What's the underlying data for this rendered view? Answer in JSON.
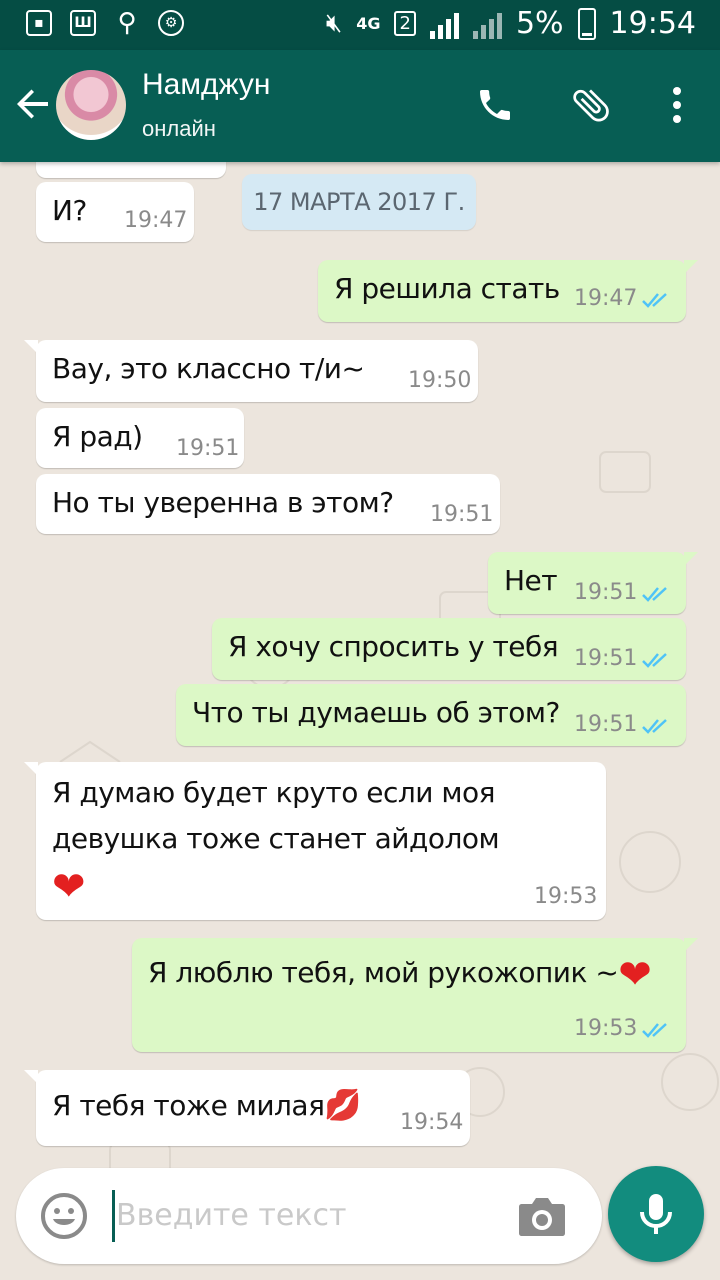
{
  "status_bar": {
    "time": "19:54",
    "battery": "5%",
    "network": "4G",
    "sim": "2"
  },
  "header": {
    "contact_name": "Намджун",
    "status": "онлайн"
  },
  "date_chip": "17 МАРТА 2017 Г.",
  "messages": [
    {
      "text": "И?",
      "time": "19:47",
      "direction": "in"
    },
    {
      "text": "Я решила стать",
      "time": "19:47",
      "direction": "out"
    },
    {
      "text": "Вау, это классно т/и~",
      "time": "19:50",
      "direction": "in"
    },
    {
      "text": "Я рад)",
      "time": "19:51",
      "direction": "in"
    },
    {
      "text": "Но ты уверенна в этом?",
      "time": "19:51",
      "direction": "in"
    },
    {
      "text": "Нет",
      "time": "19:51",
      "direction": "out"
    },
    {
      "text": "Я хочу спросить у тебя",
      "time": "19:51",
      "direction": "out"
    },
    {
      "text": "Что ты думаешь об этом?",
      "time": "19:51",
      "direction": "out"
    },
    {
      "text": "Я думаю будет круто если моя девушка тоже станет айдолом",
      "time": "19:53",
      "direction": "in",
      "emoji": "❤"
    },
    {
      "text": "Я люблю тебя, мой рукожопик ~",
      "time": "19:53",
      "direction": "out",
      "emoji": "❤"
    },
    {
      "text": "Я тебя тоже милая",
      "time": "19:54",
      "direction": "in",
      "emoji": "💋"
    }
  ],
  "input": {
    "placeholder": "Введите текст"
  },
  "colors": {
    "header": "#075E54",
    "status_bar": "#054D44",
    "outgoing_bubble": "#DCF8C6",
    "incoming_bubble": "#FFFFFF",
    "chat_background": "#ECE5DD",
    "read_ticks": "#4FC3F7",
    "mic_button": "#128C7E"
  },
  "icons": [
    "back-arrow-icon",
    "phone-icon",
    "attach-icon",
    "more-vert-icon",
    "emoji-icon",
    "camera-icon",
    "mic-icon",
    "read-ticks-icon"
  ]
}
